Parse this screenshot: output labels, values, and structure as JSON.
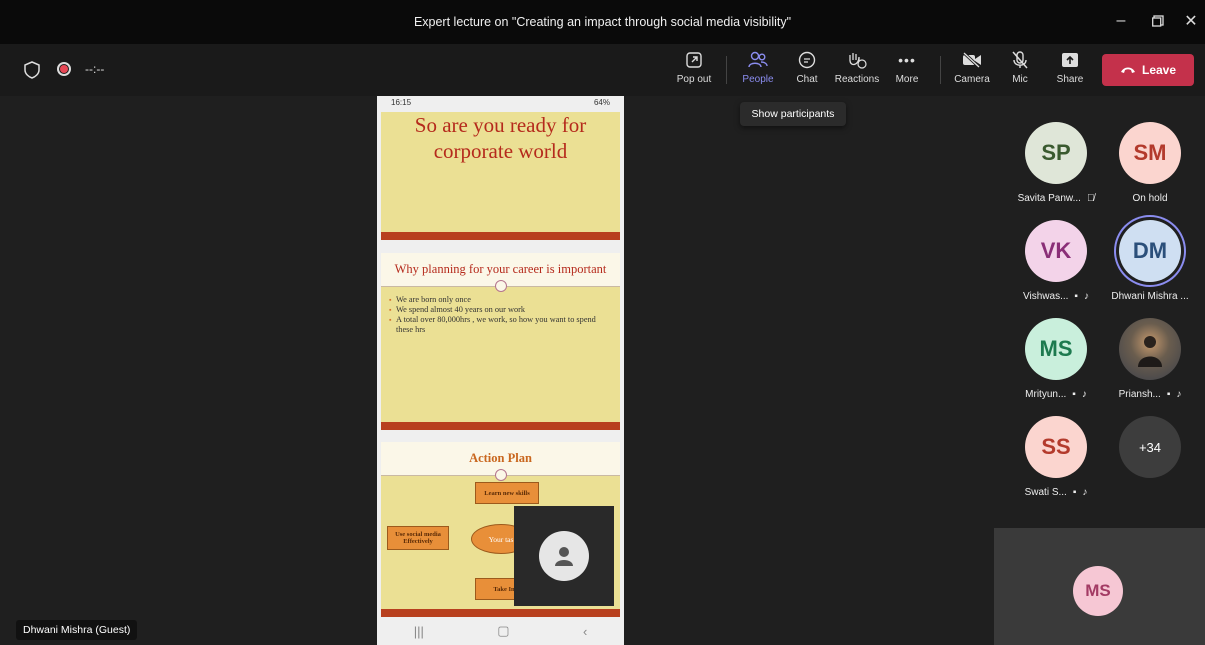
{
  "window": {
    "title": "Expert lecture on \"Creating an impact through social media visibility\""
  },
  "toolbar": {
    "timer": "--:--",
    "buttons": [
      {
        "label": "Pop out",
        "icon": "pop-out-icon"
      },
      {
        "label": "People",
        "icon": "people-icon",
        "active": true
      },
      {
        "label": "Chat",
        "icon": "chat-icon"
      },
      {
        "label": "Reactions",
        "icon": "reactions-icon"
      },
      {
        "label": "More",
        "icon": "more-icon"
      },
      {
        "label": "Camera",
        "icon": "camera-off-icon"
      },
      {
        "label": "Mic",
        "icon": "mic-off-icon"
      },
      {
        "label": "Share",
        "icon": "share-icon"
      }
    ],
    "leave_label": "Leave",
    "tooltip": "Show participants"
  },
  "shared_screen": {
    "status_time": "16:15",
    "status_right": "64%",
    "slide1_title": "So are you ready for corporate world",
    "slide2_title": "Why planning for your career is important",
    "slide2_bullets": [
      "We are born only once",
      "We spend almost 40 years on our work",
      "A total over 80,000hrs , we work, so how you want to spend these hrs"
    ],
    "slide3_title": "Action Plan",
    "slide3_boxes": {
      "top": "Learn new skills",
      "left": "Use social media Effectively",
      "center": "Your tas",
      "bottom": "Take Init"
    }
  },
  "self_name": "Dhwani Mishra (Guest)",
  "participants": [
    {
      "initials": "SP",
      "name": "Savita Panw...",
      "bg": "#dfe6d8",
      "fg": "#3a5a2f"
    },
    {
      "initials": "SM",
      "name": "On hold",
      "bg": "#fbd5cf",
      "fg": "#b33a2c"
    },
    {
      "initials": "VK",
      "name": "Vishwas...",
      "bg": "#f3d3e9",
      "fg": "#8a2e77"
    },
    {
      "initials": "DM",
      "name": "Dhwani Mishra ...",
      "bg": "#cfdff2",
      "fg": "#2b4f7a"
    },
    {
      "initials": "MS",
      "name": "Mrityun...",
      "bg": "#c9efdc",
      "fg": "#1d7a4f"
    },
    {
      "initials": "",
      "name": "Priansh...",
      "bg": "#6a5d4e",
      "fg": "#fff"
    },
    {
      "initials": "SS",
      "name": "Swati S...",
      "bg": "#fbd5cf",
      "fg": "#b33a2c"
    },
    {
      "initials": "+34",
      "name": "",
      "bg": "#3d3d3d",
      "fg": "#fff"
    }
  ],
  "bottom_tile_initials": "MS"
}
